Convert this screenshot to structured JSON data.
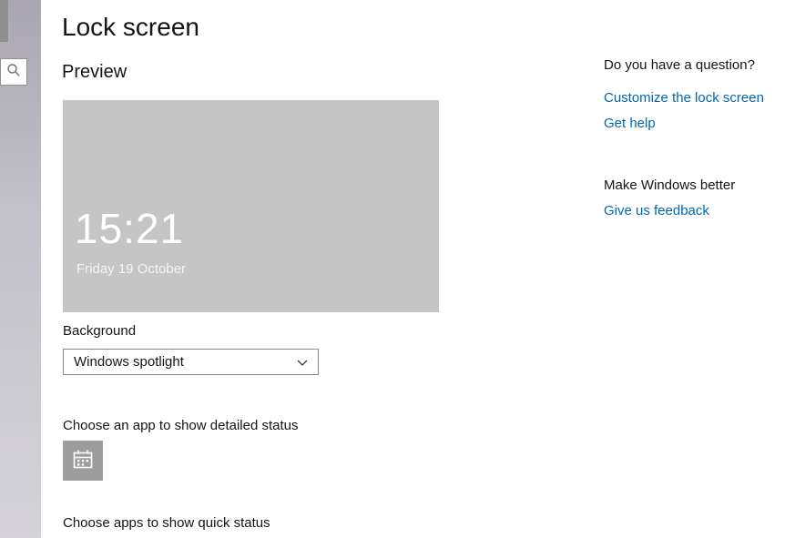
{
  "window": {
    "title": "Lock screen"
  },
  "sections": {
    "preview_label": "Preview",
    "background_label": "Background",
    "background_value": "Windows spotlight",
    "detailed_status_label": "Choose an app to show detailed status",
    "quick_status_label": "Choose apps to show quick status"
  },
  "preview": {
    "time": "15:21",
    "date": "Friday 19 October"
  },
  "help_panel": {
    "question_heading": "Do you have a question?",
    "customize_link": "Customize the lock screen",
    "get_help_link": "Get help",
    "feedback_heading": "Make Windows better",
    "feedback_link": "Give us feedback"
  },
  "icons": {
    "search": "search-icon",
    "chevron": "chevron-down-icon",
    "calendar": "calendar-icon"
  },
  "colors": {
    "link": "#0066b4",
    "preview_background": "#c5c5c5",
    "tile_background": "#9d9d9d",
    "strip_top": "#a9a6b1",
    "strip_bottom": "#d5d3d9"
  }
}
